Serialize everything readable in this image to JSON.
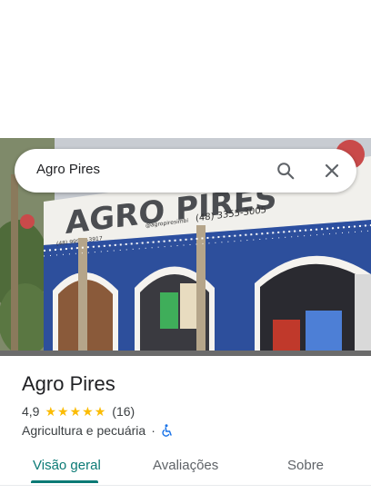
{
  "search": {
    "query": "Agro Pires"
  },
  "photo": {
    "sign_text": "AGRO PIRES",
    "sign_handle": "@agropiresimbi",
    "sign_phone": "(48) 3355-3005",
    "sign_phone_left": "(48) 99979-3917"
  },
  "place": {
    "name": "Agro Pires",
    "rating": "4,9",
    "stars": 5,
    "review_count": "(16)",
    "category": "Agricultura e pecuária",
    "separator": "·"
  },
  "tabs": [
    {
      "label": "Visão geral",
      "active": true
    },
    {
      "label": "Avaliações",
      "active": false
    },
    {
      "label": "Sobre",
      "active": false
    }
  ],
  "colors": {
    "accent": "#0b7a75",
    "star": "#fbbc04",
    "accessibility": "#1a73e8"
  },
  "icons": {
    "search": "search-icon",
    "close": "close-icon",
    "accessibility": "wheelchair-icon"
  }
}
